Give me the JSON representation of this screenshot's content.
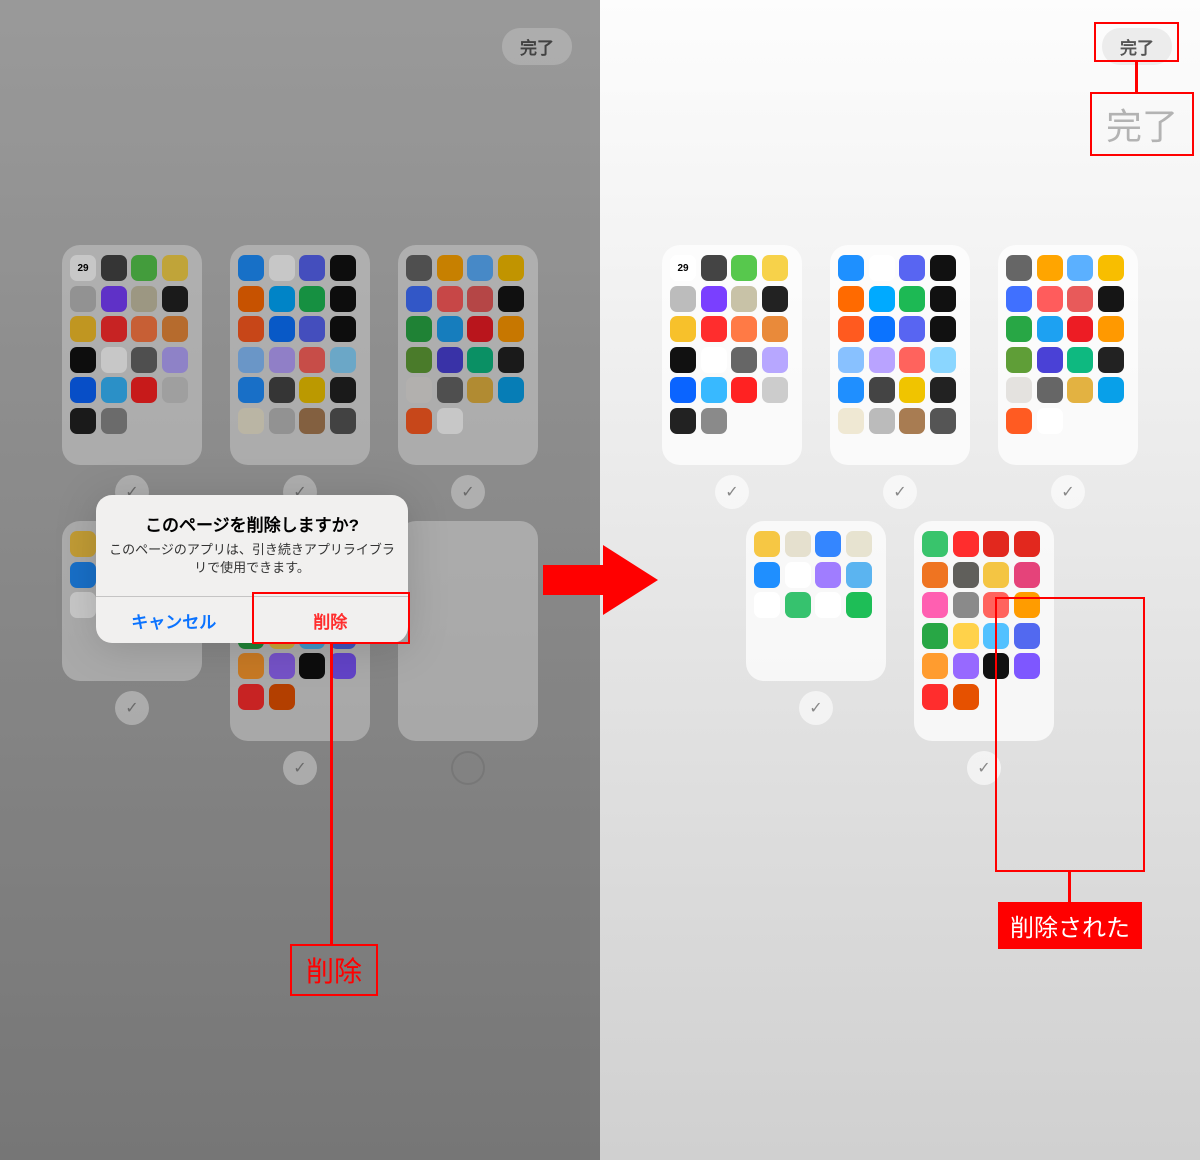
{
  "dialog": {
    "title": "このページを削除しますか?",
    "message": "このページのアプリは、引き続きアプリライブラリで使用できます。",
    "cancel": "キャンセル",
    "delete": "削除"
  },
  "done_label": "完了",
  "callouts": {
    "delete": "削除",
    "done": "完了",
    "deleted": "削除された"
  },
  "checkmark": "✓",
  "left_pages": [
    {
      "rows": 6,
      "checked": true,
      "apps": [
        "#fff",
        "#444",
        "#57c84d",
        "#f7d24a",
        "#bcbcbc",
        "#7a3fff",
        "#c8c2a7",
        "#222",
        "#f7c12b",
        "#ff2d2d",
        "#ff7a45",
        "#e98a3a",
        "#111",
        "#fff",
        "#666",
        "#b7a7ff",
        "#0a64ff",
        "#38b9ff",
        "#ff2222",
        "#ccc",
        "#222",
        "#8a8a8a"
      ],
      "calendar": "29"
    },
    {
      "rows": 6,
      "checked": true,
      "apps": [
        "#1e90ff",
        "#fff",
        "#5865f2",
        "#111",
        "#ff6a00",
        "#00aaff",
        "#1db954",
        "#111",
        "#ff5a1f",
        "#0b73ff",
        "#5865f2",
        "#111",
        "#88c1ff",
        "#b9a3ff",
        "#ff635d",
        "#8ad6ff",
        "#1f8fff",
        "#444",
        "#f0c400",
        "#222",
        "#efe8d3",
        "#bbb",
        "#a87c52",
        "#555"
      ]
    },
    {
      "rows": 5,
      "checked": true,
      "apps": [
        "#666",
        "#ffa500",
        "#5bb0ff",
        "#f8be00",
        "#4070ff",
        "#ff5c5c",
        "#e85a5a",
        "#151515",
        "#28a745",
        "#1da1f2",
        "#ed1c24",
        "#ff9900",
        "#5f9e37",
        "#4a41d6",
        "#0eb980",
        "#222",
        "#e4e2df",
        "#666",
        "#e3b241",
        "#08a0e9",
        "#ff5b22",
        "#fff"
      ]
    },
    {
      "rows": 3,
      "checked": true,
      "short": true,
      "apps": [
        "#f6c744",
        "#e5e0ce",
        "#3486ff",
        "#e7e3d0",
        "#1f8fff",
        "#fff",
        "#a07dff",
        "#5bb4f0",
        "#fff",
        "#36c26e",
        "#fff",
        "#1ebe57"
      ]
    },
    {
      "rows": 5,
      "checked": true,
      "short": false,
      "apps": [
        "#39c46c",
        "#ff2d2d",
        "#e2281e",
        "#e2281e",
        "#ef7421",
        "#605f5b",
        "#f4c543",
        "#e5437a",
        "#ff5fb1",
        "#8a8a8a",
        "#ff635d",
        "#ff9c00",
        "#28a745",
        "#ffd24a",
        "#52c1ff",
        "#5269f0",
        "#ff9c2f",
        "#9769ff",
        "#111",
        "#7e57ff",
        "#ff2d2d",
        "#e65100"
      ]
    },
    {
      "rows": 0,
      "checked": false,
      "hollow": true,
      "short": false,
      "apps": []
    }
  ],
  "right_pages": [
    {
      "rows": 6,
      "checked": true,
      "apps": [
        "#fff",
        "#444",
        "#57c84d",
        "#f7d24a",
        "#bcbcbc",
        "#7a3fff",
        "#c8c2a7",
        "#222",
        "#f7c12b",
        "#ff2d2d",
        "#ff7a45",
        "#e98a3a",
        "#111",
        "#fff",
        "#666",
        "#b7a7ff",
        "#0a64ff",
        "#38b9ff",
        "#ff2222",
        "#ccc",
        "#222",
        "#8a8a8a"
      ],
      "calendar": "29"
    },
    {
      "rows": 6,
      "checked": true,
      "apps": [
        "#1e90ff",
        "#fff",
        "#5865f2",
        "#111",
        "#ff6a00",
        "#00aaff",
        "#1db954",
        "#111",
        "#ff5a1f",
        "#0b73ff",
        "#5865f2",
        "#111",
        "#88c1ff",
        "#b9a3ff",
        "#ff635d",
        "#8ad6ff",
        "#1f8fff",
        "#444",
        "#f0c400",
        "#222",
        "#efe8d3",
        "#bbb",
        "#a87c52",
        "#555"
      ]
    },
    {
      "rows": 5,
      "checked": true,
      "apps": [
        "#666",
        "#ffa500",
        "#5bb0ff",
        "#f8be00",
        "#4070ff",
        "#ff5c5c",
        "#e85a5a",
        "#151515",
        "#28a745",
        "#1da1f2",
        "#ed1c24",
        "#ff9900",
        "#5f9e37",
        "#4a41d6",
        "#0eb980",
        "#222",
        "#e4e2df",
        "#666",
        "#e3b241",
        "#08a0e9",
        "#ff5b22",
        "#fff"
      ]
    },
    {
      "rows": 3,
      "checked": true,
      "short": true,
      "apps": [
        "#f6c744",
        "#e5e0ce",
        "#3486ff",
        "#e7e3d0",
        "#1f8fff",
        "#fff",
        "#a07dff",
        "#5bb4f0",
        "#fff",
        "#36c26e",
        "#fff",
        "#1ebe57"
      ]
    },
    {
      "rows": 5,
      "checked": true,
      "short": false,
      "apps": [
        "#39c46c",
        "#ff2d2d",
        "#e2281e",
        "#e2281e",
        "#ef7421",
        "#605f5b",
        "#f4c543",
        "#e5437a",
        "#ff5fb1",
        "#8a8a8a",
        "#ff635d",
        "#ff9c00",
        "#28a745",
        "#ffd24a",
        "#52c1ff",
        "#5269f0",
        "#ff9c2f",
        "#9769ff",
        "#111",
        "#7e57ff",
        "#ff2d2d",
        "#e65100"
      ]
    }
  ]
}
